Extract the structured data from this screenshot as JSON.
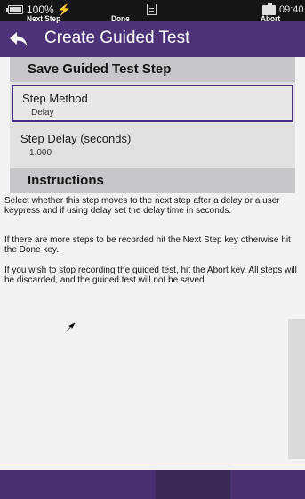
{
  "status_bar": {
    "battery_percent": "100%",
    "charging_symbol": "⚡",
    "time": "09:40"
  },
  "title_bar": {
    "title": "Create Guided Test"
  },
  "save_section": {
    "header": "Save Guided Test Step",
    "step_method": {
      "label": "Step Method",
      "value": "Delay"
    },
    "step_delay": {
      "label": "Step Delay (seconds)",
      "value": "1.000"
    }
  },
  "instructions": {
    "header": "Instructions",
    "paragraphs": [
      "Select whether this step moves to the next step after a delay or a user keypress and if using delay set the delay time in seconds.",
      "If there are more steps to be recorded hit the Next Step key otherwise hit the Done key.",
      "If you wish to stop recording the guided test, hit the Abort key. All steps will be discarded, and the guided test will not be saved."
    ]
  },
  "softkeys": {
    "next_step": "Next Step",
    "done": "Done",
    "abort": "Abort"
  },
  "colors": {
    "accent": "#4e3278",
    "selection_border": "#4b2e83"
  }
}
